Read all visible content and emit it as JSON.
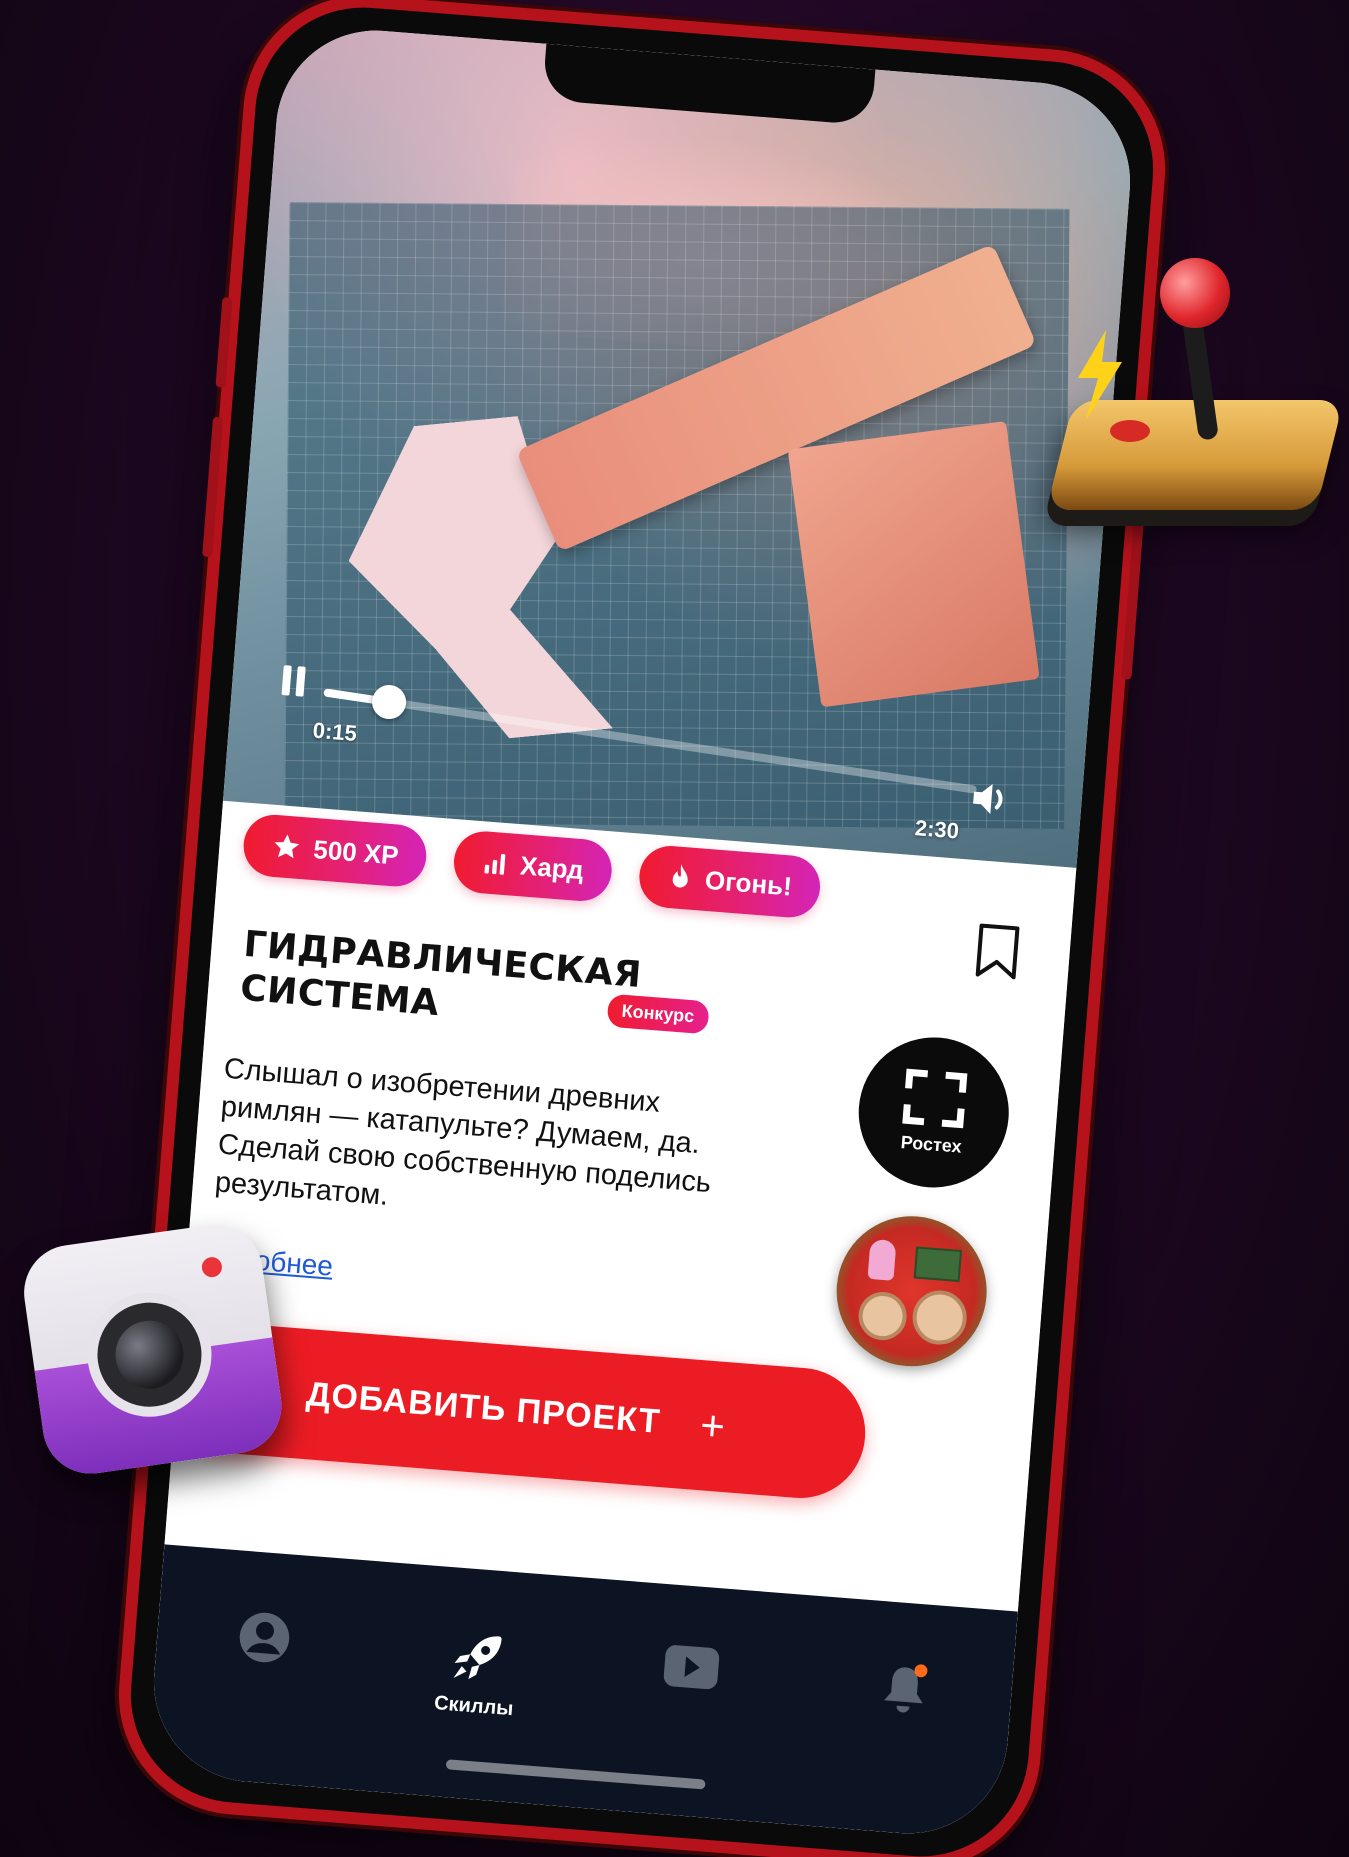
{
  "video": {
    "current_time": "0:15",
    "total_time": "2:30",
    "progress": 0.1
  },
  "tags": [
    {
      "label": "500 XP",
      "icon": "star-icon"
    },
    {
      "label": "Хард",
      "icon": "signal-bars-icon"
    },
    {
      "label": "Огонь!",
      "icon": "fire-icon"
    }
  ],
  "project": {
    "title": "ГИДРАВЛИЧЕСКАЯ СИСТЕМА",
    "contest_badge": "Конкурс",
    "description": "Слышал о изобретении древних римлян — катапульте? Думаем, да. Сделай свою собственную поделись результатом.",
    "more_link": "дробнее",
    "partner_name": "Ростех"
  },
  "actions": {
    "add_project_label": "ДОБАВИТЬ ПРОЕКТ",
    "add_icon": "+"
  },
  "nav": {
    "items": [
      {
        "name": "profile",
        "icon": "user-icon",
        "label": ""
      },
      {
        "name": "skills",
        "icon": "rocket-icon",
        "label": "Скиллы"
      },
      {
        "name": "video",
        "icon": "play-icon",
        "label": ""
      },
      {
        "name": "notifications",
        "icon": "bell-icon",
        "label": ""
      }
    ]
  },
  "colors": {
    "accent_red": "#ec1c24",
    "tag_gradient_start": "#f01b2f",
    "tag_gradient_end": "#d424b8",
    "nav_bg": "#0c1424",
    "background": "#1c0720"
  }
}
